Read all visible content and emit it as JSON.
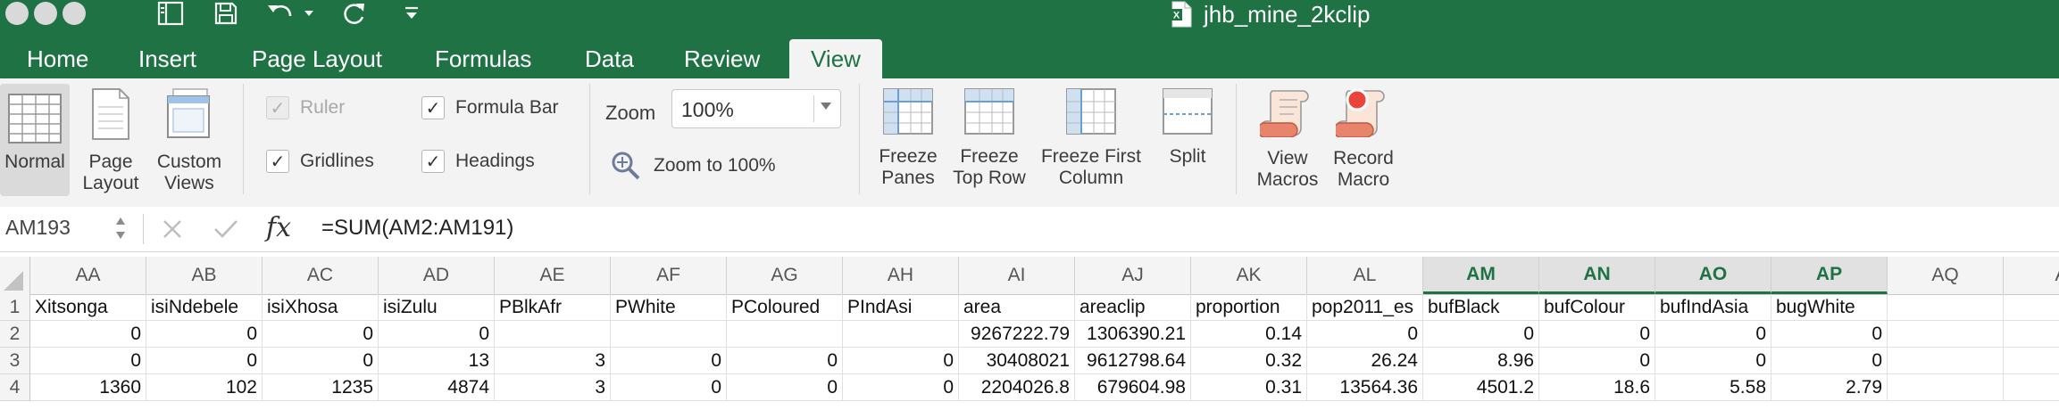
{
  "window": {
    "title": "jhb_mine_2kclip"
  },
  "ribbon_tabs": [
    "Home",
    "Insert",
    "Page Layout",
    "Formulas",
    "Data",
    "Review",
    "View"
  ],
  "active_tab": "View",
  "ribbon": {
    "workbook_views": [
      {
        "line1": "Normal",
        "line2": ""
      },
      {
        "line1": "Page",
        "line2": "Layout"
      },
      {
        "line1": "Custom",
        "line2": "Views"
      }
    ],
    "show": {
      "ruler": "Ruler",
      "gridlines": "Gridlines",
      "formula_bar": "Formula Bar",
      "headings": "Headings"
    },
    "zoom": {
      "label": "Zoom",
      "value": "100%",
      "zoom_to_100": "Zoom to 100%"
    },
    "window_buttons": [
      {
        "line1": "Freeze",
        "line2": "Panes"
      },
      {
        "line1": "Freeze",
        "line2": "Top Row"
      },
      {
        "line1": "Freeze First",
        "line2": "Column"
      },
      {
        "line1": "Split",
        "line2": ""
      }
    ],
    "macro_buttons": [
      {
        "line1": "View",
        "line2": "Macros"
      },
      {
        "line1": "Record",
        "line2": "Macro"
      }
    ]
  },
  "formula_bar": {
    "name_box": "AM193",
    "fx": "fx",
    "formula": "=SUM(AM2:AM191)"
  },
  "sheet": {
    "columns": [
      "AA",
      "AB",
      "AC",
      "AD",
      "AE",
      "AF",
      "AG",
      "AH",
      "AI",
      "AJ",
      "AK",
      "AL",
      "AM",
      "AN",
      "AO",
      "AP",
      "AQ",
      "A"
    ],
    "selected_columns": [
      "AM",
      "AN",
      "AO",
      "AP"
    ],
    "row_numbers": [
      "1",
      "2",
      "3",
      "4"
    ],
    "rows": [
      [
        "Xitsonga",
        "isiNdebele",
        "isiXhosa",
        "isiZulu",
        "PBlkAfr",
        "PWhite",
        "PColoured",
        "PIndAsi",
        "area",
        "areaclip",
        "proportion",
        "pop2011_es",
        "bufBlack",
        "bufColour",
        "bufIndAsia",
        "bugWhite",
        "",
        ""
      ],
      [
        "0",
        "0",
        "0",
        "0",
        "",
        "",
        "",
        "",
        "9267222.79",
        "1306390.21",
        "0.14",
        "0",
        "0",
        "0",
        "0",
        "0",
        "",
        ""
      ],
      [
        "0",
        "0",
        "0",
        "13",
        "3",
        "0",
        "0",
        "0",
        "30408021",
        "9612798.64",
        "0.32",
        "26.24",
        "8.96",
        "0",
        "0",
        "0",
        "",
        ""
      ],
      [
        "1360",
        "102",
        "1235",
        "4874",
        "3",
        "0",
        "0",
        "0",
        "2204026.8",
        "679604.98",
        "0.31",
        "13564.36",
        "4501.2",
        "18.6",
        "5.58",
        "2.79",
        "",
        ""
      ]
    ]
  }
}
